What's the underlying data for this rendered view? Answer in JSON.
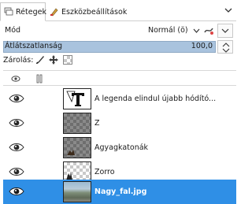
{
  "tabs": [
    {
      "label": "Rétegek",
      "icon": "layers-icon",
      "active": true
    },
    {
      "label": "Eszközbeállítások",
      "icon": "tool-options-icon",
      "active": false
    }
  ],
  "mode": {
    "label": "Mód",
    "value": "Normál (ö)"
  },
  "opacity": {
    "label": "Átlátszatlanság",
    "value": "100,0",
    "fill_fraction": 1.0
  },
  "lock": {
    "label": "Zárolás:",
    "icons": [
      "paint-lock-icon",
      "move-lock-icon",
      "alpha-lock-icon"
    ]
  },
  "list_header": {
    "icons": [
      "visibility-header-icon",
      "chain-header-icon"
    ]
  },
  "layers": [
    {
      "name": "A legenda elindul újabb hódító...",
      "type": "text",
      "selected": false
    },
    {
      "name": "Z",
      "type": "transparent",
      "selected": false
    },
    {
      "name": "Agyagkatonák",
      "type": "transparent",
      "selected": false
    },
    {
      "name": "Zorro",
      "type": "transparent-light",
      "selected": false
    },
    {
      "name": "Nagy_fal.jpg",
      "type": "photo",
      "selected": true
    }
  ],
  "colors": {
    "selection": "#2f8fe6",
    "opacity_bar": "#a9c3de"
  }
}
